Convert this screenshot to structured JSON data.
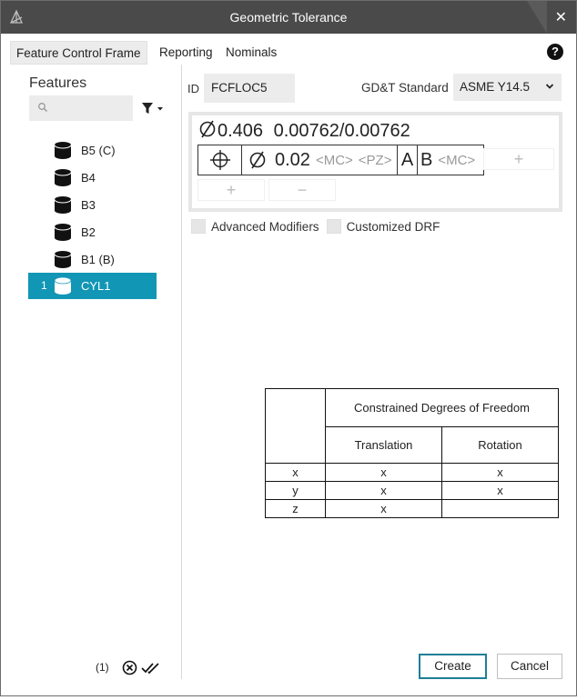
{
  "window": {
    "title": "Geometric Tolerance",
    "close_glyph": "✕"
  },
  "tabs": [
    {
      "label": "Feature Control Frame",
      "active": true
    },
    {
      "label": "Reporting",
      "active": false
    },
    {
      "label": "Nominals",
      "active": false
    }
  ],
  "help_glyph": "?",
  "sidebar": {
    "heading": "Features",
    "search": {
      "placeholder": "",
      "value": ""
    },
    "features": [
      {
        "number": "",
        "label": "B5 (C)",
        "selected": false
      },
      {
        "number": "",
        "label": "B4",
        "selected": false
      },
      {
        "number": "",
        "label": "B3",
        "selected": false
      },
      {
        "number": "",
        "label": "B2",
        "selected": false
      },
      {
        "number": "",
        "label": "B1 (B)",
        "selected": false
      },
      {
        "number": "1",
        "label": "CYL1",
        "selected": true
      }
    ],
    "footer": {
      "count": "(1)"
    }
  },
  "form": {
    "id_label": "ID",
    "id_value": "FCFLOC5",
    "standard_label": "GD&T Standard",
    "standard_value": "ASME Y14.5"
  },
  "fcf": {
    "feature_size": "0.406",
    "tolerance_plus": "0.00762",
    "separator": "/",
    "tolerance_minus": "0.00762",
    "tolerance_value": "0.02",
    "material_modifier": "<MC>",
    "zone_modifier": "<PZ>",
    "datum_a": "A",
    "datum_b": "B",
    "datum_b_modifier": "<MC>",
    "add_glyph": "+",
    "remove_glyph": "−"
  },
  "options": {
    "advanced_modifiers": "Advanced Modifiers",
    "customized_drf": "Customized DRF"
  },
  "dof_table": {
    "header": "Constrained Degrees of Freedom",
    "col_translation": "Translation",
    "col_rotation": "Rotation",
    "rows": [
      {
        "axis": "x",
        "translation": "x",
        "rotation": "x"
      },
      {
        "axis": "y",
        "translation": "x",
        "rotation": "x"
      },
      {
        "axis": "z",
        "translation": "x",
        "rotation": ""
      }
    ]
  },
  "buttons": {
    "create": "Create",
    "cancel": "Cancel"
  },
  "colors": {
    "titlebar": "#4a4a4a",
    "selection": "#1296b5",
    "primary_border": "#1e7f96"
  }
}
